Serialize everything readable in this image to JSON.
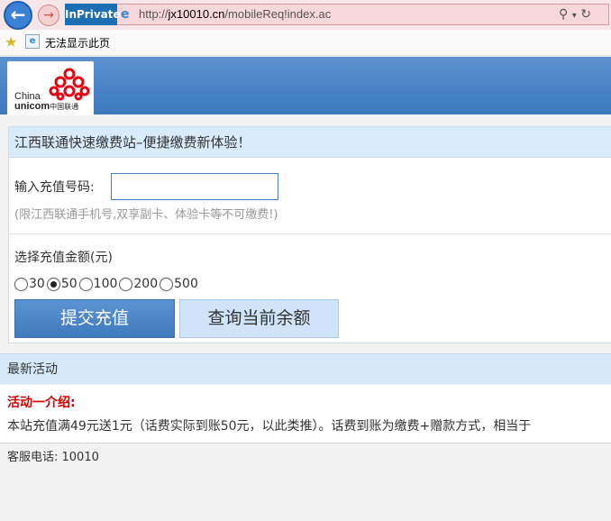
{
  "browser": {
    "inprivate_label": "InPrivate",
    "url_prefix": "http://",
    "url_host": "jx10010.cn",
    "url_path": "/mobileReq!index.ac",
    "favorites_item": "无法显示此页"
  },
  "logo": {
    "line1": "China",
    "line2": "unicom",
    "line2_cn": "中国联通",
    "colors": {
      "knot": "#e60012"
    }
  },
  "form": {
    "title": "江西联通快速缴费站–便捷缴费新体验！",
    "phone_label": "输入充值号码:",
    "phone_value": "",
    "hint": "(限江西联通手机号,双享副卡、体验卡等不可缴费!)",
    "amount_label": "选择充值金额(元)",
    "amounts": [
      {
        "label": "30",
        "selected": false
      },
      {
        "label": "50",
        "selected": true
      },
      {
        "label": "100",
        "selected": false
      },
      {
        "label": "200",
        "selected": false
      },
      {
        "label": "500",
        "selected": false
      }
    ],
    "submit_label": "提交充值",
    "query_label": "查询当前余额"
  },
  "news": {
    "title": "最新活动",
    "promo_title": "活动一介绍:",
    "promo_text": "本站充值满49元送1元（话费实际到账50元，以此类推）。话费到账为缴费+赠款方式，相当于"
  },
  "footer": {
    "service": "客服电话: 10010"
  },
  "colors": {
    "accent": "#3d78bf",
    "panel_header": "#d8ebfb",
    "promo_title": "#d40000"
  }
}
